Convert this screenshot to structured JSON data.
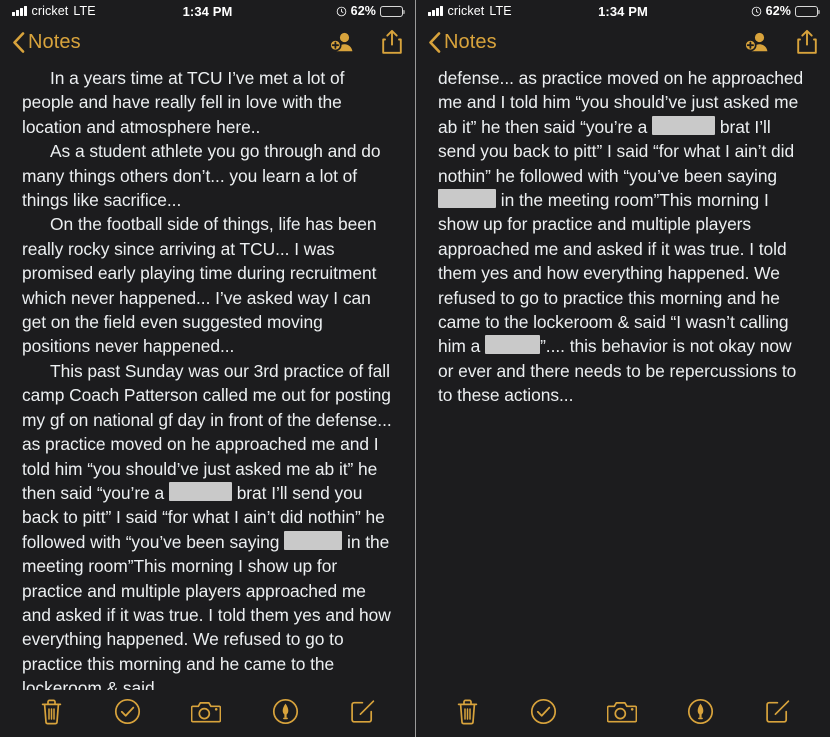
{
  "status_bar": {
    "carrier": "cricket",
    "network": "LTE",
    "time": "1:34 PM",
    "battery_percent": "62%",
    "battery_level": 62,
    "signal_bars": 4,
    "alarm_icon": "alarm-clock-icon",
    "battery_icon": "battery-icon"
  },
  "nav_bar": {
    "back_label": "Notes",
    "back_icon": "chevron-left-icon",
    "add_person_icon": "add-person-icon",
    "share_icon": "share-icon"
  },
  "colors": {
    "accent": "#d8a33c",
    "background": "#1c1c1e",
    "text": "#eceff1",
    "redaction": "#c9c9c9",
    "divider": "#9a9a9a"
  },
  "toolbar": {
    "items": [
      {
        "name": "delete-button",
        "icon": "trash-icon",
        "label": "Delete"
      },
      {
        "name": "checklist-button",
        "icon": "check-circle-icon",
        "label": "Checklist"
      },
      {
        "name": "camera-button",
        "icon": "camera-icon",
        "label": "Camera"
      },
      {
        "name": "markup-button",
        "icon": "markup-pen-icon",
        "label": "Markup"
      },
      {
        "name": "compose-button",
        "icon": "compose-icon",
        "label": "New Note"
      }
    ]
  },
  "left_panel": {
    "paragraphs": [
      {
        "indent": true,
        "segments": [
          {
            "type": "text",
            "value": "In a years time at TCU I’ve met a lot of people and have really fell in love with the location and atmosphere here.."
          }
        ]
      },
      {
        "indent": true,
        "segments": [
          {
            "type": "text",
            "value": "As a student athlete you go through and do many things others don’t... you learn a lot of things like sacrifice..."
          }
        ]
      },
      {
        "indent": true,
        "segments": [
          {
            "type": "text",
            "value": "On the football side of things, life has been really rocky since arriving at TCU... I was promised early playing time during recruitment which never happened... I’ve asked way I can get on the field even suggested moving positions never happened..."
          }
        ]
      },
      {
        "indent": true,
        "segments": [
          {
            "type": "text",
            "value": "This past Sunday was our 3rd practice of fall camp Coach Patterson called me out for posting my gf on national gf day in front of the defense... as practice moved on he approached me and I told him “you should’ve just asked me ab it” he then said “you’re a "
          },
          {
            "type": "redaction",
            "width": "r-w1"
          },
          {
            "type": "text",
            "value": " brat I’ll send you back to pitt” I said “for what I ain’t did nothin” he followed with “you’ve been saying "
          },
          {
            "type": "redaction",
            "width": "r-w2"
          },
          {
            "type": "text",
            "value": " in the meeting room”This morning I show up for practice and multiple players approached me and asked if it was true. I told them yes and how everything happened. We refused to go to practice this morning and he came to the lockeroom & said"
          }
        ]
      }
    ]
  },
  "right_panel": {
    "paragraphs": [
      {
        "indent": false,
        "segments": [
          {
            "type": "text",
            "value": "defense... as practice moved on he approached me and I told him “you should’ve just asked me ab it” he then said “you’re a "
          },
          {
            "type": "redaction",
            "width": "r-w1"
          },
          {
            "type": "text",
            "value": " brat I’ll send you back to pitt” I said “for what I ain’t did nothin” he followed with “you’ve been saying "
          },
          {
            "type": "redaction",
            "width": "r-w2"
          },
          {
            "type": "text",
            "value": " in the meeting room”This morning I show up for practice and multiple players approached me and asked if it was true. I told them yes and how everything happened. We refused to go to practice this morning and he came to the lockeroom & said “I wasn’t calling him a "
          },
          {
            "type": "redaction",
            "width": "r-w3"
          },
          {
            "type": "text",
            "value": "”.... this behavior is not okay now or ever and there needs to be repercussions to to these actions..."
          }
        ]
      }
    ]
  }
}
